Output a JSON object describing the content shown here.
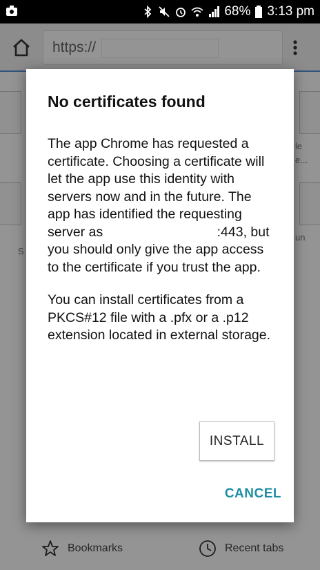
{
  "status_bar": {
    "battery_pct": "68%",
    "time": "3:13 pm"
  },
  "toolbar": {
    "url_prefix": "https://"
  },
  "background_page": {
    "side_texts": [
      "le",
      "e...",
      "un",
      "S"
    ],
    "bottom_bar": {
      "bookmarks_label": "Bookmarks",
      "recent_tabs_label": "Recent tabs"
    }
  },
  "dialog": {
    "title": "No certificates found",
    "para1_before": "The app Chrome has requested a certificate. Choosing a certificate will let the app use this identity with servers now and in the future. The app has identified the requesting server as",
    "para1_port": ":443, but you should only give the app access to the certificate if you trust the app.",
    "para2": "You can install certificates from a PKCS#12 file with a .pfx or a .p12 extension located in external storage.",
    "install_label": "INSTALL",
    "cancel_label": "CANCEL"
  },
  "colors": {
    "cancel_accent": "#1e8fa3",
    "scrim": "rgba(0,0,0,0.42)"
  }
}
